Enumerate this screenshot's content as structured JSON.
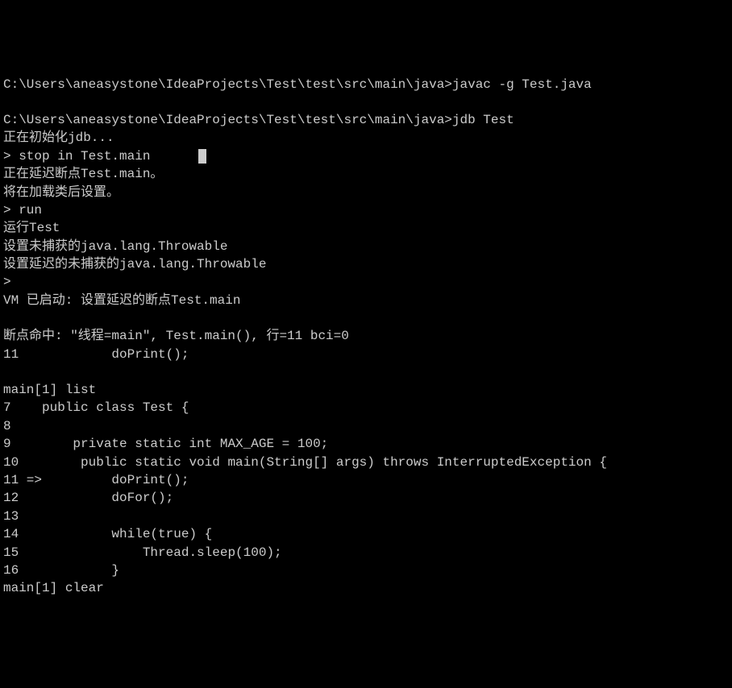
{
  "lines": [
    "C:\\Users\\aneasystone\\IdeaProjects\\Test\\test\\src\\main\\java>javac -g Test.java",
    "",
    "C:\\Users\\aneasystone\\IdeaProjects\\Test\\test\\src\\main\\java>jdb Test",
    "正在初始化jdb...",
    "> stop in Test.main",
    "正在延迟断点Test.main。",
    "将在加载类后设置。",
    "> run",
    "运行Test",
    "设置未捕获的java.lang.Throwable",
    "设置延迟的未捕获的java.lang.Throwable",
    ">",
    "VM 已启动: 设置延迟的断点Test.main",
    "",
    "断点命中: \"线程=main\", Test.main(), 行=11 bci=0",
    "11            doPrint();",
    "",
    "main[1] list",
    "7    public class Test {",
    "8",
    "9        private static int MAX_AGE = 100;",
    "10        public static void main(String[] args) throws InterruptedException {",
    "11 =>         doPrint();",
    "12            doFor();",
    "13",
    "14            while(true) {",
    "15                Thread.sleep(100);",
    "16            }",
    "main[1] clear"
  ],
  "cursor_line_index": 4
}
